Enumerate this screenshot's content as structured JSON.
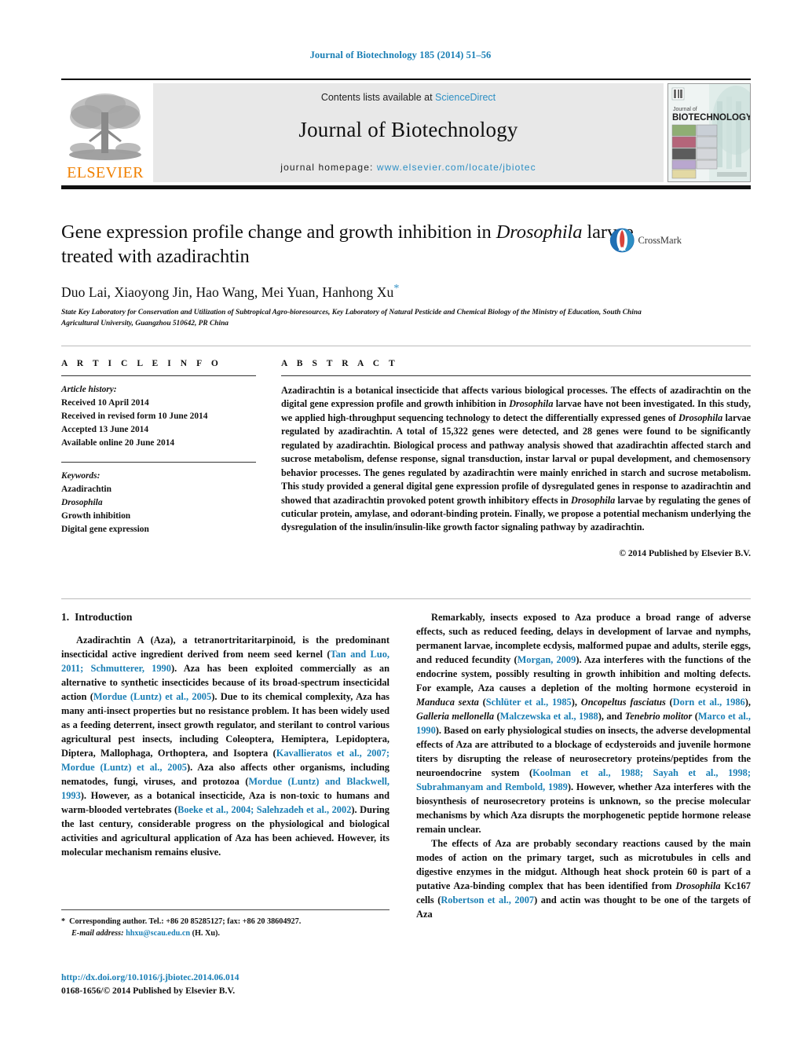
{
  "running_head": "Journal of Biotechnology 185 (2014) 51–56",
  "masthead": {
    "publisher_logo_text": "ELSEVIER",
    "contents_prefix": "Contents lists available at",
    "contents_link": "ScienceDirect",
    "journal_title": "Journal of Biotechnology",
    "homepage_label": "journal homepage:",
    "homepage_url": "www.elsevier.com/locate/jbiotec",
    "cover_title_small": "Journal of",
    "cover_title_main": "BIOTECHNOLOGY"
  },
  "article": {
    "title_part1": "Gene expression profile change and growth inhibition in ",
    "title_italic": "Drosophila",
    "title_part2": " larvae treated with azadirachtin",
    "authors": "Duo Lai, Xiaoyong Jin, Hao Wang, Mei Yuan, Hanhong Xu",
    "corresponding_marker": "*",
    "affiliation": "State Key Laboratory for Conservation and Utilization of Subtropical Agro-bioresources, Key Laboratory of Natural Pesticide and Chemical Biology of the Ministry of Education, South China Agricultural University, Guangzhou 510642, PR China",
    "crossmark_label": "CrossMark"
  },
  "article_info": {
    "heading": "A R T I C L E  I N F O",
    "history_label": "Article history:",
    "history": [
      "Received 10 April 2014",
      "Received in revised form 10 June 2014",
      "Accepted 13 June 2014",
      "Available online 20 June 2014"
    ],
    "keywords_label": "Keywords:",
    "keywords": [
      "Azadirachtin",
      "Drosophila",
      "Growth inhibition",
      "Digital gene expression"
    ],
    "keywords_italic_index": 1
  },
  "abstract": {
    "heading": "A B S T R A C T",
    "text_a": "Azadirachtin is a botanical insecticide that affects various biological processes. The effects of azadirachtin on the digital gene expression profile and growth inhibition in ",
    "italic_1": "Drosophila",
    "text_b": " larvae have not been investigated. In this study, we applied high-throughput sequencing technology to detect the differentially expressed genes of ",
    "italic_2": "Drosophila",
    "text_c": " larvae regulated by azadirachtin. A total of 15,322 genes were detected, and 28 genes were found to be significantly regulated by azadirachtin. Biological process and pathway analysis showed that azadirachtin affected starch and sucrose metabolism, defense response, signal transduction, instar larval or pupal development, and chemosensory behavior processes. The genes regulated by azadirachtin were mainly enriched in starch and sucrose metabolism. This study provided a general digital gene expression profile of dysregulated genes in response to azadirachtin and showed that azadirachtin provoked potent growth inhibitory effects in ",
    "italic_3": "Drosophila",
    "text_d": " larvae by regulating the genes of cuticular protein, amylase, and odorant-binding protein. Finally, we propose a potential mechanism underlying the dysregulation of the insulin/insulin-like growth factor signaling pathway by azadirachtin.",
    "copyright": "© 2014 Published by Elsevier B.V."
  },
  "sections": {
    "intro_number": "1.",
    "intro_title": "Introduction"
  },
  "footnote": {
    "star": "*",
    "corresponding": "Corresponding author. Tel.: +86 20 85285127; fax: +86 20 38604927.",
    "email_label": "E-mail address:",
    "email": "hhxu@scau.edu.cn",
    "email_suffix": "(H. Xu)."
  },
  "footer": {
    "doi": "http://dx.doi.org/10.1016/j.jbiotec.2014.06.014",
    "issn": "0168-1656/© 2014 Published by Elsevier B.V."
  },
  "colors": {
    "link_blue": "#1a7fb5",
    "elsevier_orange": "#f08000",
    "sciencedirect_blue": "#2d8fc4"
  }
}
